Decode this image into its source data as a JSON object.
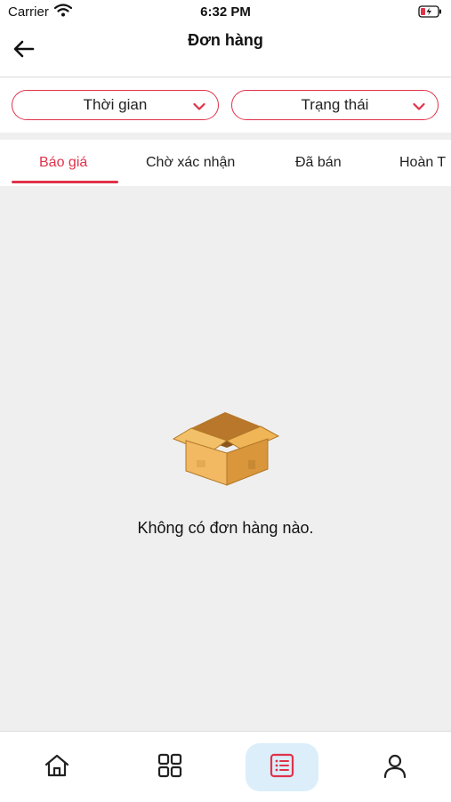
{
  "status_bar": {
    "carrier": "Carrier",
    "time": "6:32 PM",
    "icons": [
      "wifi-icon",
      "battery-charging-icon"
    ]
  },
  "header": {
    "title": "Đơn hàng",
    "back_icon": "arrow-left-icon"
  },
  "filters": [
    {
      "label": "Thời gian",
      "icon": "chevron-down-icon"
    },
    {
      "label": "Trạng thái",
      "icon": "chevron-down-icon"
    }
  ],
  "tabs": [
    {
      "label": "Báo giá",
      "active": true
    },
    {
      "label": "Chờ xác nhận",
      "active": false
    },
    {
      "label": "Đã bán",
      "active": false
    },
    {
      "label": "Hoàn T",
      "active": false
    }
  ],
  "empty_state": {
    "icon": "open-box-icon",
    "message": "Không có đơn hàng nào."
  },
  "bottom_nav": [
    {
      "icon": "home-icon",
      "active": false
    },
    {
      "icon": "grid-icon",
      "active": false
    },
    {
      "icon": "order-list-icon",
      "active": true
    },
    {
      "icon": "user-icon",
      "active": false
    }
  ],
  "colors": {
    "accent": "#e0334a",
    "background": "#efefef",
    "active_nav_bg": "#dbeefa",
    "box_light": "#f1b65a",
    "box_dark": "#c9872d"
  }
}
